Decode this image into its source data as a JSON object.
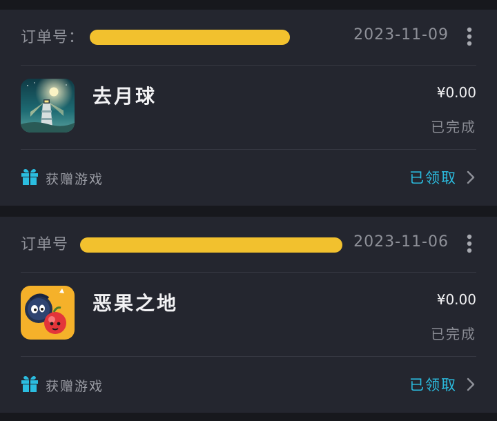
{
  "orders": [
    {
      "order_label": "订单号：",
      "date": "2023-11-09",
      "game_title": "去月球",
      "price": "¥0.00",
      "status": "已完成",
      "gift_label": "获赠游戏",
      "claim_label": "已领取",
      "icon": "to-the-moon-game-icon"
    },
    {
      "order_label": "订单号",
      "date": "2023-11-06",
      "game_title": "恶果之地",
      "price": "¥0.00",
      "status": "已完成",
      "gift_label": "获赠游戏",
      "claim_label": "已领取",
      "icon": "bad-fruit-land-game-icon"
    }
  ],
  "colors": {
    "background": "#17181d",
    "card": "#24262f",
    "redaction": "#f2c12e",
    "accent": "#2bbde0",
    "muted_text": "#8f9199",
    "title_text": "#f2f2f4"
  },
  "icons": {
    "more": "more-vertical-icon",
    "gift": "gift-icon",
    "chevron": "chevron-right-icon"
  }
}
